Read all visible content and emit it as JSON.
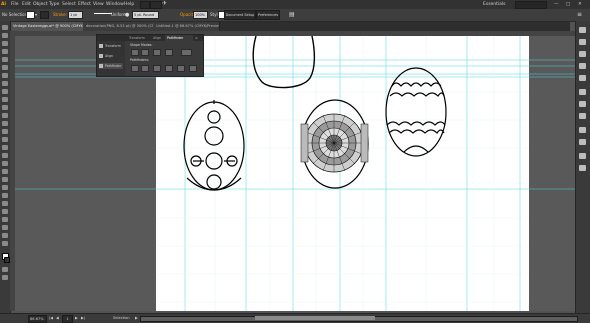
{
  "app": {
    "logo": "Ai",
    "workspace": "Essentials"
  },
  "menu": [
    "File",
    "Edit",
    "Object",
    "Type",
    "Select",
    "Effect",
    "View",
    "Window",
    "Help"
  ],
  "control": {
    "selection_label": "No Selection",
    "stroke_label": "Stroke:",
    "stroke_weight": "1 pt",
    "profile": "Uniform",
    "brush": "5 pt. Round",
    "opacity_label": "Opacity:",
    "opacity_value": "100%",
    "style_label": "Style:",
    "doc_setup_button": "Document Setup",
    "preferences_button": "Preferences"
  },
  "tabs": [
    {
      "label": "Vintage Eastereggs.ai* @ 900% (CMYK/Preview)",
      "active": true
    },
    {
      "label": "decoration(PNG, 8.53 pt) @ 300% (CMYK/Preview)",
      "active": false
    },
    {
      "label": "Untitled-1 @ 66.67% (CMYK/Preview)",
      "active": false
    }
  ],
  "pathfinder_panel": {
    "tabs": [
      "Transform",
      "Align",
      "Pathfinder"
    ],
    "active_tab": "Pathfinder",
    "left_items": [
      "Transform",
      "Align",
      "Pathfinder"
    ],
    "shape_modes_label": "Shape Modes:",
    "pathfinders_label": "Pathfinders:"
  },
  "status": {
    "zoom": "66.67%",
    "page": "1",
    "mode": "Selection"
  },
  "colors": {
    "ui_dark": "#323232",
    "pasteboard": "#595959",
    "artboard": "#ffffff",
    "guide": "#4fd6e0",
    "egg_stroke": "#000000"
  }
}
